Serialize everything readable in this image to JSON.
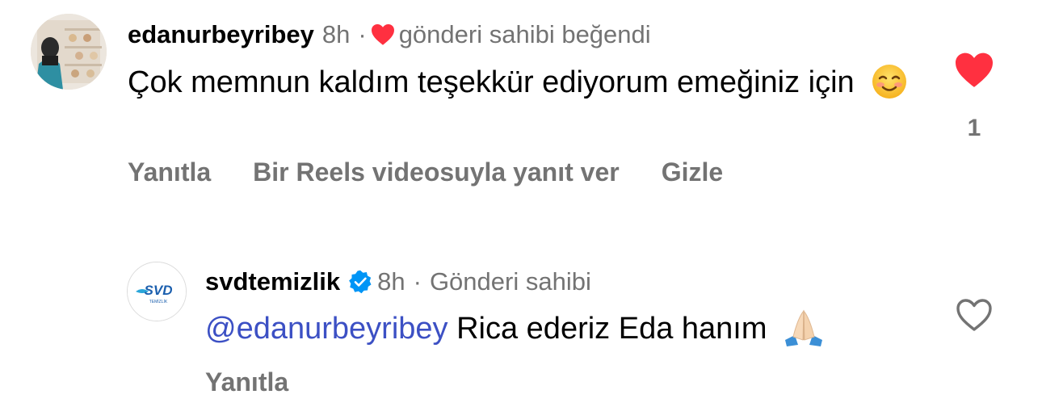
{
  "comment": {
    "username": "edanurbeyribey",
    "time": "8h",
    "separator": "·",
    "liked_by_author_text": "gönderi sahibi beğendi",
    "text": "Çok memnun kaldım teşekkür ediyorum emeğiniz için",
    "like_count": "1",
    "actions": {
      "reply": "Yanıtla",
      "reels_reply": "Bir Reels videosuyla yanıt ver",
      "hide": "Gizle"
    },
    "liked": true
  },
  "reply": {
    "username": "svdtemizlik",
    "time": "8h",
    "separator": "·",
    "author_label": "Gönderi sahibi",
    "mention": "@edanurbeyribey",
    "text": "Rica ederiz Eda hanım",
    "actions": {
      "reply": "Yanıtla"
    },
    "liked": false,
    "avatar_logo_text": "SVD",
    "avatar_logo_subtext": "TEMİZLİK"
  },
  "colors": {
    "like_red": "#ff3040",
    "secondary_text": "#737373",
    "mention_blue": "#3c50c4",
    "verified_blue": "#0095f6"
  },
  "icons": {
    "comment_emoji": "smiling-face-icon",
    "reply_emoji": "folded-hands-icon",
    "verified": "verified-badge-icon",
    "like_filled": "heart-filled-icon",
    "like_outline": "heart-outline-icon"
  }
}
